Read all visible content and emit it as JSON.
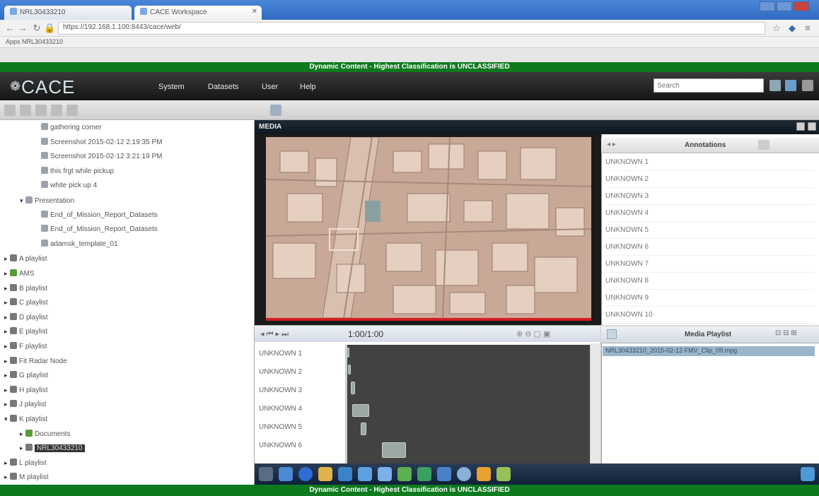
{
  "browser": {
    "tabs": [
      {
        "label": "NRL30433210"
      },
      {
        "label": "CACE Workspace"
      }
    ],
    "url": "https://192.168.1.100:8443/cace/web/",
    "url_proto": "https",
    "bookmarks": "Apps  NRL30433210"
  },
  "app": {
    "banner_top": "Dynamic Content - Highest Classification is UNCLASSIFIED",
    "banner_bottom": "Dynamic Content - Highest Classification is UNCLASSIFIED",
    "logo": "CACE",
    "menus": [
      "System",
      "Datasets",
      "User",
      "Help"
    ],
    "search_placeholder": "Search"
  },
  "tree": {
    "items": [
      {
        "label": "gathering corner",
        "indent": 3,
        "icon": "doc"
      },
      {
        "label": "Screenshot 2015-02-12 2:19:35 PM",
        "indent": 3,
        "icon": "doc"
      },
      {
        "label": "Screenshot 2015-02-12 3:21:19 PM",
        "indent": 3,
        "icon": "doc"
      },
      {
        "label": "this frgt while pickup",
        "indent": 3,
        "icon": "doc"
      },
      {
        "label": "white pick up 4",
        "indent": 3,
        "icon": "doc"
      },
      {
        "label": "Presentation",
        "indent": 2,
        "icon": "doc",
        "toggle": "▾"
      },
      {
        "label": "End_of_Mission_Report_Datasets",
        "indent": 3,
        "icon": "doc"
      },
      {
        "label": "End_of_Mission_Report_Datasets",
        "indent": 3,
        "icon": "doc"
      },
      {
        "label": "adamsk_template_01",
        "indent": 3,
        "icon": "doc"
      },
      {
        "label": "A playlist",
        "indent": 1,
        "icon": "item",
        "toggle": "▸"
      },
      {
        "label": "AMS",
        "indent": 1,
        "icon": "folder",
        "toggle": "▸"
      },
      {
        "label": "B playlist",
        "indent": 1,
        "icon": "item",
        "toggle": "▸"
      },
      {
        "label": "C playlist",
        "indent": 1,
        "icon": "item",
        "toggle": "▸"
      },
      {
        "label": "D playlist",
        "indent": 1,
        "icon": "item",
        "toggle": "▸"
      },
      {
        "label": "E playlist",
        "indent": 1,
        "icon": "item",
        "toggle": "▸"
      },
      {
        "label": "F playlist",
        "indent": 1,
        "icon": "item",
        "toggle": "▸"
      },
      {
        "label": "Fit Radar Node",
        "indent": 1,
        "icon": "item",
        "toggle": "▸"
      },
      {
        "label": "G playlist",
        "indent": 1,
        "icon": "item",
        "toggle": "▸"
      },
      {
        "label": "H playlist",
        "indent": 1,
        "icon": "item",
        "toggle": "▸"
      },
      {
        "label": "J playlist",
        "indent": 1,
        "icon": "item",
        "toggle": "▸"
      },
      {
        "label": "K playlist",
        "indent": 1,
        "icon": "item",
        "toggle": "▾"
      },
      {
        "label": "Documents",
        "indent": 2,
        "icon": "folder",
        "toggle": "▸"
      },
      {
        "label": "NRL30433210",
        "indent": 2,
        "icon": "item",
        "toggle": "▸",
        "selected": true
      },
      {
        "label": "L playlist",
        "indent": 1,
        "icon": "item",
        "toggle": "▸"
      },
      {
        "label": "M playlist",
        "indent": 1,
        "icon": "item",
        "toggle": "▸"
      }
    ]
  },
  "media": {
    "header": "MEDIA",
    "annotations_title": "Annotations",
    "annotations": [
      "UNKNOWN 1",
      "UNKNOWN 2",
      "UNKNOWN 3",
      "UNKNOWN 4",
      "UNKNOWN 5",
      "UNKNOWN 6",
      "UNKNOWN 7",
      "UNKNOWN 8",
      "UNKNOWN 9",
      "UNKNOWN 10"
    ],
    "timecode": "1:00/1:00",
    "tracks": [
      "UNKNOWN 1",
      "UNKNOWN 2",
      "UNKNOWN 3",
      "UNKNOWN 4",
      "UNKNOWN 5",
      "UNKNOWN 6"
    ],
    "playlist_title": "Media Playlist",
    "playlist_item": "NRL30433210_2015-02-12 FMV_Clip_09.mpg"
  },
  "colors": {
    "banner": "#0d7a1e",
    "header": "#1c1c1c",
    "progress": "#d02020",
    "selection": "#333333"
  }
}
